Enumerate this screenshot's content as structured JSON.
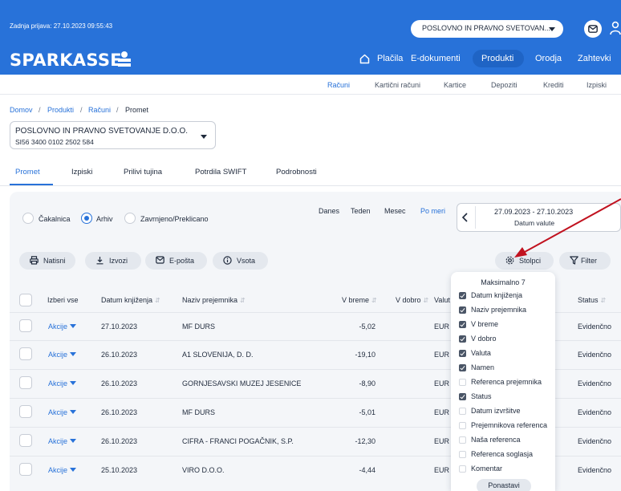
{
  "header": {
    "last_login": "Zadnja prijava: 27.10.2023 09:55:43",
    "company_select": "POSLOVNO IN PRAVNO SVETOVAN...",
    "logo_text": "SPARKASSE",
    "nav": [
      "Plačila",
      "E-dokumenti",
      "Produkti",
      "Orodja",
      "Zahtevki"
    ],
    "nav_active": "Produkti"
  },
  "subnav": {
    "items": [
      "Računi",
      "Kartični računi",
      "Kartice",
      "Depoziti",
      "Krediti",
      "Izpiski"
    ],
    "active": "Računi"
  },
  "breadcrumb": [
    "Domov",
    "Produkti",
    "Računi",
    "Promet"
  ],
  "account": {
    "name": "POSLOVNO IN PRAVNO SVETOVANJE D.O.O.",
    "iban": "SI56 3400 0102 2502 584"
  },
  "tabs": [
    "Promet",
    "Izpiski",
    "Prilivi tujina",
    "Potrdila SWIFT",
    "Podrobnosti"
  ],
  "tabs_active": "Promet",
  "filters": {
    "status_options": [
      "Čakalnica",
      "Arhiv",
      "Zavrnjeno/Preklicano"
    ],
    "status_selected": "Arhiv",
    "periods": [
      "Danes",
      "Teden",
      "Mesec",
      "Po meri"
    ],
    "period_active": "Po meri",
    "date_range": "27.09.2023 - 27.10.2023",
    "date_type": "Datum valute"
  },
  "actions": {
    "print": "Natisni",
    "export": "Izvozi",
    "email": "E-pošta",
    "sum": "Vsota",
    "columns": "Stolpci",
    "filter": "Filter"
  },
  "table": {
    "headers": {
      "select_all": "Izberi vse",
      "booking_date": "Datum knjiženja",
      "recipient": "Naziv prejemnika",
      "debit": "V breme",
      "credit": "V dobro",
      "currency": "Valut",
      "status": "Status"
    },
    "rows": [
      {
        "action": "Akcije",
        "date": "27.10.2023",
        "recipient": "MF DURS",
        "debit": "-5,02",
        "currency": "EUR",
        "status": "Evidenčno"
      },
      {
        "action": "Akcije",
        "date": "26.10.2023",
        "recipient": "A1 SLOVENIJA, D. D.",
        "debit": "-19,10",
        "currency": "EUR",
        "status": "Evidenčno"
      },
      {
        "action": "Akcije",
        "date": "26.10.2023",
        "recipient": "GORNJESAVSKI MUZEJ JESENICE",
        "debit": "-8,90",
        "currency": "EUR",
        "status": "Evidenčno"
      },
      {
        "action": "Akcije",
        "date": "26.10.2023",
        "recipient": "MF DURS",
        "debit": "-5,01",
        "currency": "EUR",
        "status": "Evidenčno"
      },
      {
        "action": "Akcije",
        "date": "26.10.2023",
        "recipient": "CIFRA - FRANCI POGAČNIK, S.P.",
        "debit": "-12,30",
        "currency": "EUR",
        "status": "Evidenčno"
      },
      {
        "action": "Akcije",
        "date": "25.10.2023",
        "recipient": "VIRO D.O.O.",
        "debit": "-4,44",
        "currency": "EUR",
        "status": "Evidenčno"
      }
    ]
  },
  "columns_menu": {
    "title": "Maksimalno 7",
    "items": [
      {
        "label": "Datum knjiženja",
        "checked": true
      },
      {
        "label": "Naziv prejemnika",
        "checked": true
      },
      {
        "label": "V breme",
        "checked": true
      },
      {
        "label": "V dobro",
        "checked": true
      },
      {
        "label": "Valuta",
        "checked": true
      },
      {
        "label": "Namen",
        "checked": true
      },
      {
        "label": "Referenca prejemnika",
        "checked": false
      },
      {
        "label": "Status",
        "checked": true
      },
      {
        "label": "Datum izvršitve",
        "checked": false
      },
      {
        "label": "Prejemnikova referenca",
        "checked": false
      },
      {
        "label": "Naša referenca",
        "checked": false
      },
      {
        "label": "Referenca soglasja",
        "checked": false
      },
      {
        "label": "Komentar",
        "checked": false
      }
    ],
    "reset": "Ponastavi"
  },
  "colors": {
    "brand_blue": "#2872d9",
    "annotation_arrow": "#c1121f"
  }
}
